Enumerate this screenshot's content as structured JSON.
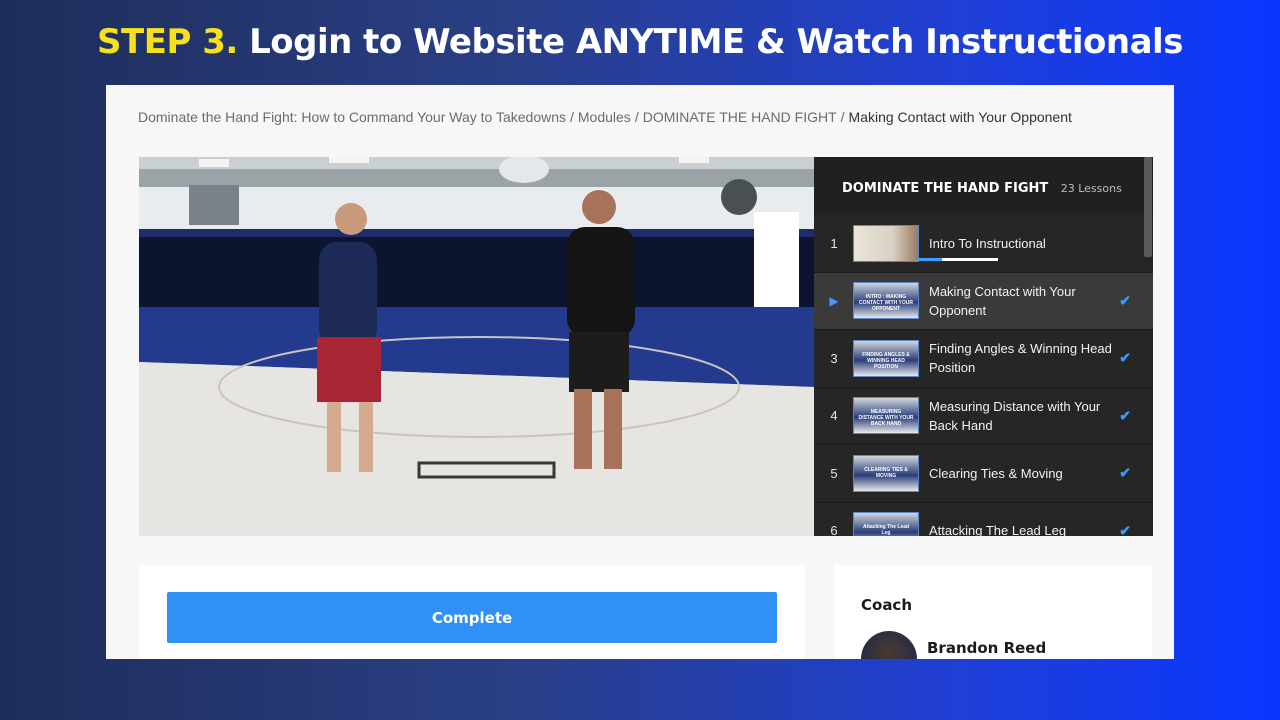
{
  "headline": {
    "step": "STEP 3.",
    "text": "Login to Website ANYTIME & Watch Instructionals"
  },
  "breadcrumb": {
    "items": [
      "Dominate the Hand Fight: How to Command Your Way to Takedowns",
      "Modules",
      "DOMINATE THE HAND FIGHT"
    ],
    "separator": "/",
    "current": "Making Contact with Your Opponent"
  },
  "sidebar": {
    "title": "DOMINATE THE HAND FIGHT",
    "count": "23 Lessons",
    "lessons": [
      {
        "num": "1",
        "label": "Intro To Instructional",
        "progress": 0.3
      },
      {
        "num": "",
        "label": "Making Contact with Your Opponent",
        "thumb_caption": "INTRO : MAKING CONTACT WITH YOUR OPPONENT"
      },
      {
        "num": "3",
        "label": "Finding Angles & Winning Head Position",
        "thumb_caption": "FINDING ANGLES & WINNING HEAD POSITION"
      },
      {
        "num": "4",
        "label": "Measuring Distance with Your Back Hand",
        "thumb_caption": "MEASURING DISTANCE WITH YOUR BACK HAND"
      },
      {
        "num": "5",
        "label": "Clearing Ties & Moving",
        "thumb_caption": "CLEARING TIES & MOVING"
      },
      {
        "num": "6",
        "label": "Attacking The Lead Leg",
        "thumb_caption": "Attacking The Lead Leg"
      }
    ]
  },
  "actions": {
    "complete_label": "Complete"
  },
  "coach": {
    "title": "Coach",
    "name": "Brandon Reed"
  },
  "colors": {
    "accent": "#3090f5",
    "step_highlight": "#f5e21b"
  }
}
